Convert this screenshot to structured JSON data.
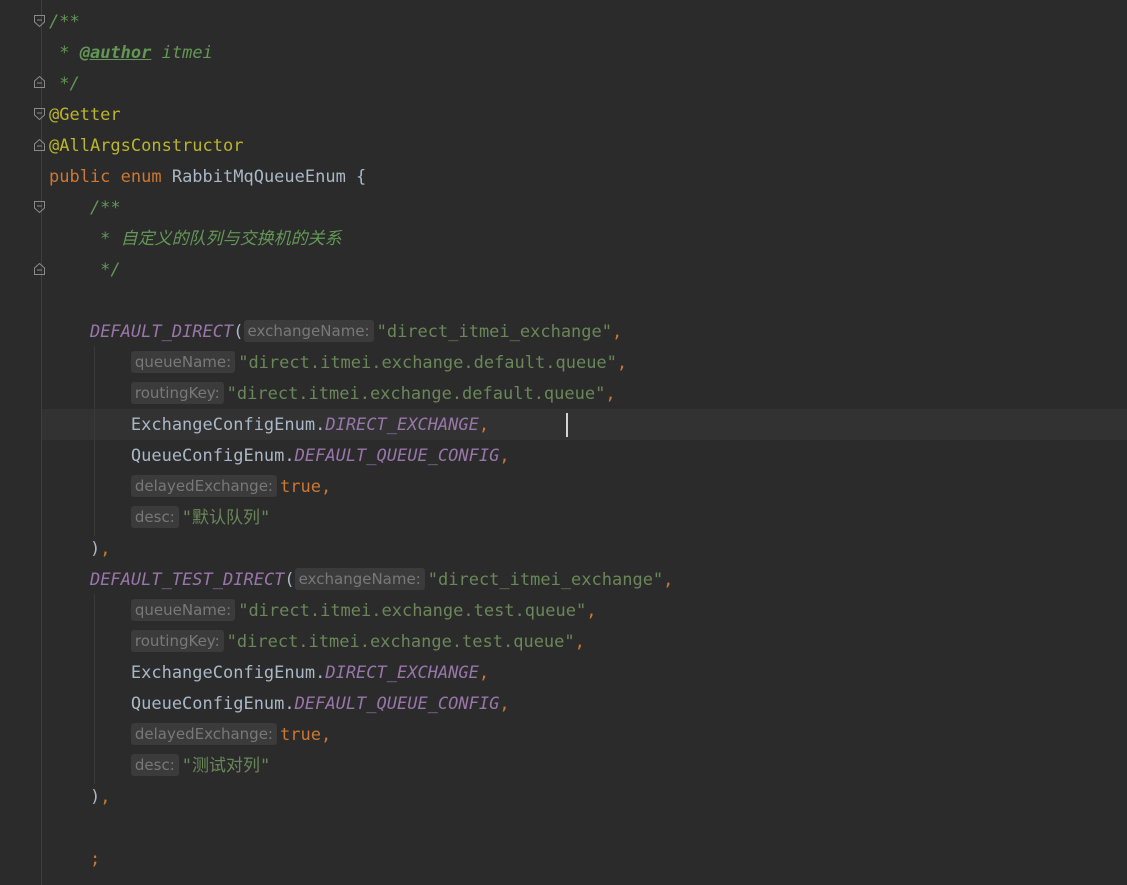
{
  "editor": {
    "lines": [
      {
        "tokens": [
          {
            "t": "comment",
            "v": "/**"
          }
        ]
      },
      {
        "tokens": [
          {
            "t": "comment",
            "v": " * "
          },
          {
            "t": "doctag",
            "v": "@author"
          },
          {
            "t": "comment",
            "v": " itmei"
          }
        ]
      },
      {
        "tokens": [
          {
            "t": "comment",
            "v": " */"
          }
        ]
      },
      {
        "tokens": [
          {
            "t": "annotation",
            "v": "@Getter"
          }
        ]
      },
      {
        "tokens": [
          {
            "t": "annotation",
            "v": "@AllArgsConstructor"
          }
        ]
      },
      {
        "tokens": [
          {
            "t": "keyword",
            "v": "public enum "
          },
          {
            "t": "plain",
            "v": "RabbitMqQueueEnum {"
          }
        ]
      },
      {
        "tokens": [
          {
            "t": "comment",
            "v": "    /**"
          }
        ]
      },
      {
        "tokens": [
          {
            "t": "comment",
            "v": "     * 自定义的队列与交换机的关系"
          }
        ]
      },
      {
        "tokens": [
          {
            "t": "comment",
            "v": "     */"
          }
        ]
      },
      {
        "tokens": []
      },
      {
        "tokens": [
          {
            "t": "plain",
            "v": "    "
          },
          {
            "t": "constant",
            "v": "DEFAULT_DIRECT"
          },
          {
            "t": "plain",
            "v": "("
          },
          {
            "t": "hint",
            "v": "exchangeName:"
          },
          {
            "t": "string",
            "v": "\"direct_itmei_exchange\""
          },
          {
            "t": "punct",
            "v": ","
          }
        ]
      },
      {
        "tokens": [
          {
            "t": "plain",
            "v": "        "
          },
          {
            "t": "hint",
            "v": "queueName:"
          },
          {
            "t": "string",
            "v": "\"direct.itmei.exchange.default.queue\""
          },
          {
            "t": "punct",
            "v": ","
          }
        ]
      },
      {
        "tokens": [
          {
            "t": "plain",
            "v": "        "
          },
          {
            "t": "hint",
            "v": "routingKey:"
          },
          {
            "t": "string",
            "v": "\"direct.itmei.exchange.default.queue\""
          },
          {
            "t": "punct",
            "v": ","
          }
        ]
      },
      {
        "tokens": [
          {
            "t": "plain",
            "v": "        ExchangeConfigEnum."
          },
          {
            "t": "constant",
            "v": "DIRECT_EXCHANGE"
          },
          {
            "t": "punct",
            "v": ","
          }
        ]
      },
      {
        "tokens": [
          {
            "t": "plain",
            "v": "        QueueConfigEnum."
          },
          {
            "t": "constant",
            "v": "DEFAULT_QUEUE_CONFIG"
          },
          {
            "t": "punct",
            "v": ","
          }
        ]
      },
      {
        "tokens": [
          {
            "t": "plain",
            "v": "        "
          },
          {
            "t": "hint",
            "v": "delayedExchange:"
          },
          {
            "t": "keyword",
            "v": "true"
          },
          {
            "t": "punct",
            "v": ","
          }
        ]
      },
      {
        "tokens": [
          {
            "t": "plain",
            "v": "        "
          },
          {
            "t": "hint",
            "v": "desc:"
          },
          {
            "t": "string",
            "v": "\"默认队列\""
          }
        ]
      },
      {
        "tokens": [
          {
            "t": "plain",
            "v": "    )"
          },
          {
            "t": "punct",
            "v": ","
          }
        ]
      },
      {
        "tokens": [
          {
            "t": "plain",
            "v": "    "
          },
          {
            "t": "constant",
            "v": "DEFAULT_TEST_DIRECT"
          },
          {
            "t": "plain",
            "v": "("
          },
          {
            "t": "hint",
            "v": "exchangeName:"
          },
          {
            "t": "string",
            "v": "\"direct_itmei_exchange\""
          },
          {
            "t": "punct",
            "v": ","
          }
        ]
      },
      {
        "tokens": [
          {
            "t": "plain",
            "v": "        "
          },
          {
            "t": "hint",
            "v": "queueName:"
          },
          {
            "t": "string",
            "v": "\"direct.itmei.exchange.test.queue\""
          },
          {
            "t": "punct",
            "v": ","
          }
        ]
      },
      {
        "tokens": [
          {
            "t": "plain",
            "v": "        "
          },
          {
            "t": "hint",
            "v": "routingKey:"
          },
          {
            "t": "string",
            "v": "\"direct.itmei.exchange.test.queue\""
          },
          {
            "t": "punct",
            "v": ","
          }
        ]
      },
      {
        "tokens": [
          {
            "t": "plain",
            "v": "        ExchangeConfigEnum."
          },
          {
            "t": "constant",
            "v": "DIRECT_EXCHANGE"
          },
          {
            "t": "punct",
            "v": ","
          }
        ]
      },
      {
        "tokens": [
          {
            "t": "plain",
            "v": "        QueueConfigEnum."
          },
          {
            "t": "constant",
            "v": "DEFAULT_QUEUE_CONFIG"
          },
          {
            "t": "punct",
            "v": ","
          }
        ]
      },
      {
        "tokens": [
          {
            "t": "plain",
            "v": "        "
          },
          {
            "t": "hint",
            "v": "delayedExchange:"
          },
          {
            "t": "keyword",
            "v": "true"
          },
          {
            "t": "punct",
            "v": ","
          }
        ]
      },
      {
        "tokens": [
          {
            "t": "plain",
            "v": "        "
          },
          {
            "t": "hint",
            "v": "desc:"
          },
          {
            "t": "string",
            "v": "\"测试对列\""
          }
        ]
      },
      {
        "tokens": [
          {
            "t": "plain",
            "v": "    )"
          },
          {
            "t": "punct",
            "v": ","
          }
        ]
      },
      {
        "tokens": []
      },
      {
        "tokens": [
          {
            "t": "punct",
            "v": "    ;"
          }
        ]
      }
    ]
  }
}
